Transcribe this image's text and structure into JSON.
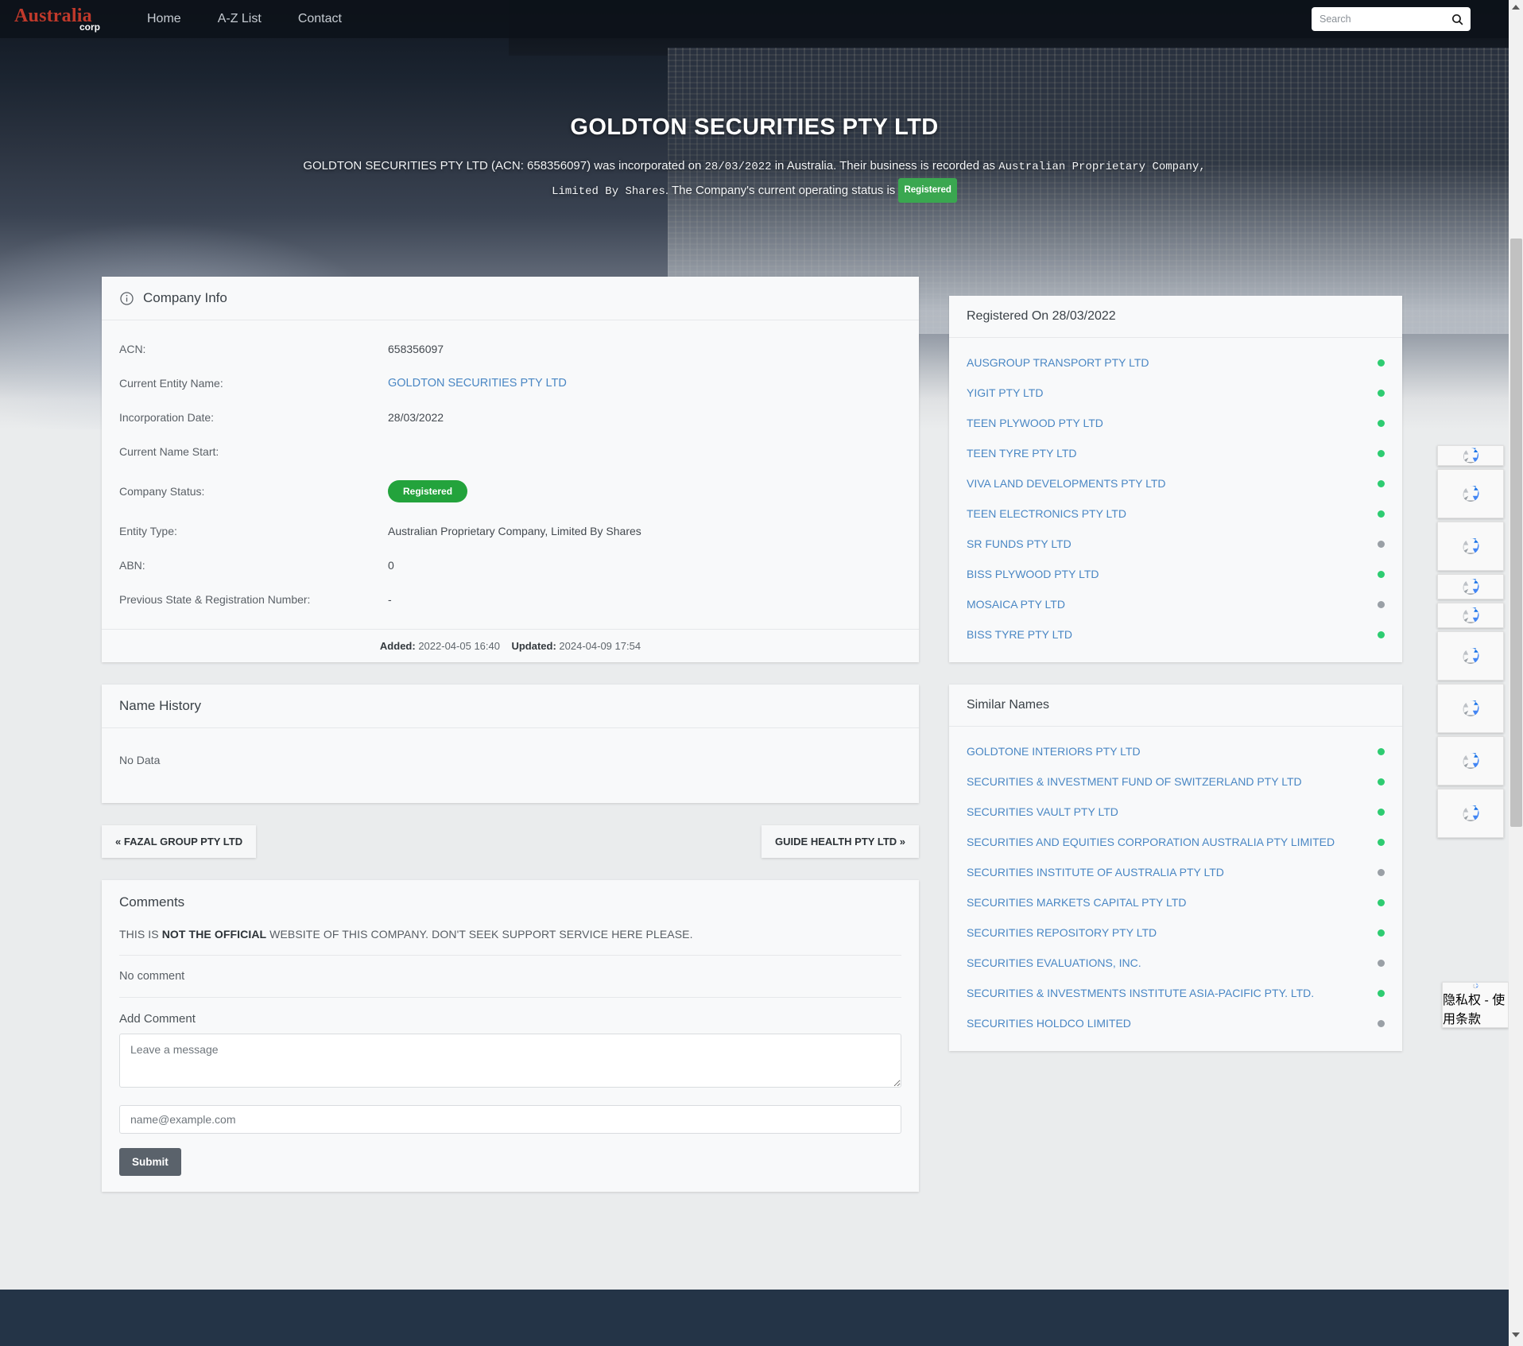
{
  "nav": {
    "brand_top": "Australia",
    "brand_bottom": "corp",
    "links": [
      "Home",
      "A-Z List",
      "Contact"
    ],
    "search_placeholder": "Search",
    "search_value": ""
  },
  "hero": {
    "title": "GOLDTON SECURITIES PTY LTD",
    "sub_p1": "GOLDTON SECURITIES PTY LTD (ACN: 658356097) was incorporated on ",
    "sub_date": "28/03/2022",
    "sub_p2": " in Australia. Their business is recorded as ",
    "sub_entity": "Australian Proprietary Company, Limited By Shares",
    "sub_p3": ". The Company's current operating status is ",
    "sub_status": "Registered"
  },
  "company_info": {
    "heading": "Company Info",
    "icon": "info-circle-icon",
    "rows": [
      {
        "label": "ACN:",
        "value": "658356097",
        "type": "text"
      },
      {
        "label": "Current Entity Name:",
        "value": "GOLDTON SECURITIES PTY LTD",
        "type": "link"
      },
      {
        "label": "Incorporation Date:",
        "value": "28/03/2022",
        "type": "text"
      },
      {
        "label": "Current Name Start:",
        "value": "",
        "type": "text"
      },
      {
        "label": "Company Status:",
        "value": "Registered",
        "type": "pill"
      },
      {
        "label": "Entity Type:",
        "value": "Australian Proprietary Company, Limited By Shares",
        "type": "text"
      },
      {
        "label": "ABN:",
        "value": "0",
        "type": "text"
      },
      {
        "label": "Previous State & Registration Number:",
        "value": "-",
        "type": "text"
      }
    ],
    "added_label": "Added:",
    "added_value": "2022-04-05 16:40",
    "updated_label": "Updated:",
    "updated_value": "2024-04-09 17:54"
  },
  "name_history": {
    "heading": "Name History",
    "empty": "No Data"
  },
  "pager": {
    "prev": "« FAZAL GROUP PTY LTD",
    "next": "GUIDE HEALTH PTY LTD »"
  },
  "comments": {
    "heading": "Comments",
    "disclaimer_pre": "THIS IS ",
    "disclaimer_strong": "NOT THE OFFICIAL",
    "disclaimer_post": " WEBSITE OF THIS COMPANY. DON'T SEEK SUPPORT SERVICE HERE PLEASE.",
    "no_comment": "No comment",
    "add_label": "Add Comment",
    "message_placeholder": "Leave a message",
    "message_value": "",
    "email_placeholder": "name@example.com",
    "email_value": "",
    "submit_label": "Submit"
  },
  "registered_on": {
    "heading": "Registered On 28/03/2022",
    "items": [
      {
        "name": "AUSGROUP TRANSPORT PTY LTD",
        "status": "active"
      },
      {
        "name": "YIGIT PTY LTD",
        "status": "active"
      },
      {
        "name": "TEEN PLYWOOD PTY LTD",
        "status": "active"
      },
      {
        "name": "TEEN TYRE PTY LTD",
        "status": "active"
      },
      {
        "name": "VIVA LAND DEVELOPMENTS PTY LTD",
        "status": "active"
      },
      {
        "name": "TEEN ELECTRONICS PTY LTD",
        "status": "active"
      },
      {
        "name": "SR FUNDS PTY LTD",
        "status": "inactive"
      },
      {
        "name": "BISS PLYWOOD PTY LTD",
        "status": "active"
      },
      {
        "name": "MOSAICA PTY LTD",
        "status": "inactive"
      },
      {
        "name": "BISS TYRE PTY LTD",
        "status": "active"
      }
    ]
  },
  "similar_names": {
    "heading": "Similar Names",
    "items": [
      {
        "name": "GOLDTONE INTERIORS PTY LTD",
        "status": "active"
      },
      {
        "name": "SECURITIES & INVESTMENT FUND OF SWITZERLAND PTY LTD",
        "status": "active"
      },
      {
        "name": "SECURITIES VAULT PTY LTD",
        "status": "active"
      },
      {
        "name": "SECURITIES AND EQUITIES CORPORATION AUSTRALIA PTY LIMITED",
        "status": "active"
      },
      {
        "name": "SECURITIES INSTITUTE OF AUSTRALIA PTY LTD",
        "status": "inactive"
      },
      {
        "name": "SECURITIES MARKETS CAPITAL PTY LTD",
        "status": "active"
      },
      {
        "name": "SECURITIES REPOSITORY PTY LTD",
        "status": "active"
      },
      {
        "name": "SECURITIES EVALUATIONS, INC.",
        "status": "inactive"
      },
      {
        "name": "SECURITIES & INVESTMENTS INSTITUTE ASIA-PACIFIC PTY. LTD.",
        "status": "active"
      },
      {
        "name": "SECURITIES HOLDCO LIMITED",
        "status": "inactive"
      }
    ]
  },
  "recaptcha": {
    "text": "隐私权 - 使用条款",
    "count": 9
  },
  "colors": {
    "accent_green": "#23a33c",
    "badge_green": "#3aa750",
    "link_blue": "#4a87c4",
    "status_active": "#2ecc71",
    "status_inactive": "#9aa0a6",
    "footer_navy": "#243447",
    "brand_red": "#c0392b"
  }
}
